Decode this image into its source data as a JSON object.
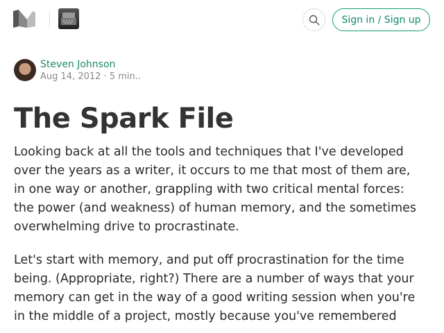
{
  "header": {
    "logo": "medium-logo",
    "publication_icon": "typewriter-image",
    "search_icon": "search-icon",
    "sign_in_label": "Sign in / Sign up"
  },
  "author": {
    "name": "Steven Johnson",
    "date": "Aug 14, 2012",
    "separator": "·",
    "read_time": "5 min.."
  },
  "article": {
    "title": "The Spark File",
    "paragraphs": [
      {
        "lines": [
          "Looking back at all the tools and techniques that I've developed",
          "over the years as a writer, it occurs to me that most of them are,",
          "in one way or another, grappling with two critical mental forces:",
          "the power (and weakness) of human memory, and the sometimes",
          "overwhelming drive to procrastinate."
        ]
      },
      {
        "lines": [
          "Let's start with memory, and put off procrastination for the time",
          "being. (Appropriate, right?) There are a number of ways that your",
          "memory can get in the way of a good writing session when you're",
          "in the middle of a project, mostly because you've remembered"
        ]
      }
    ]
  }
}
